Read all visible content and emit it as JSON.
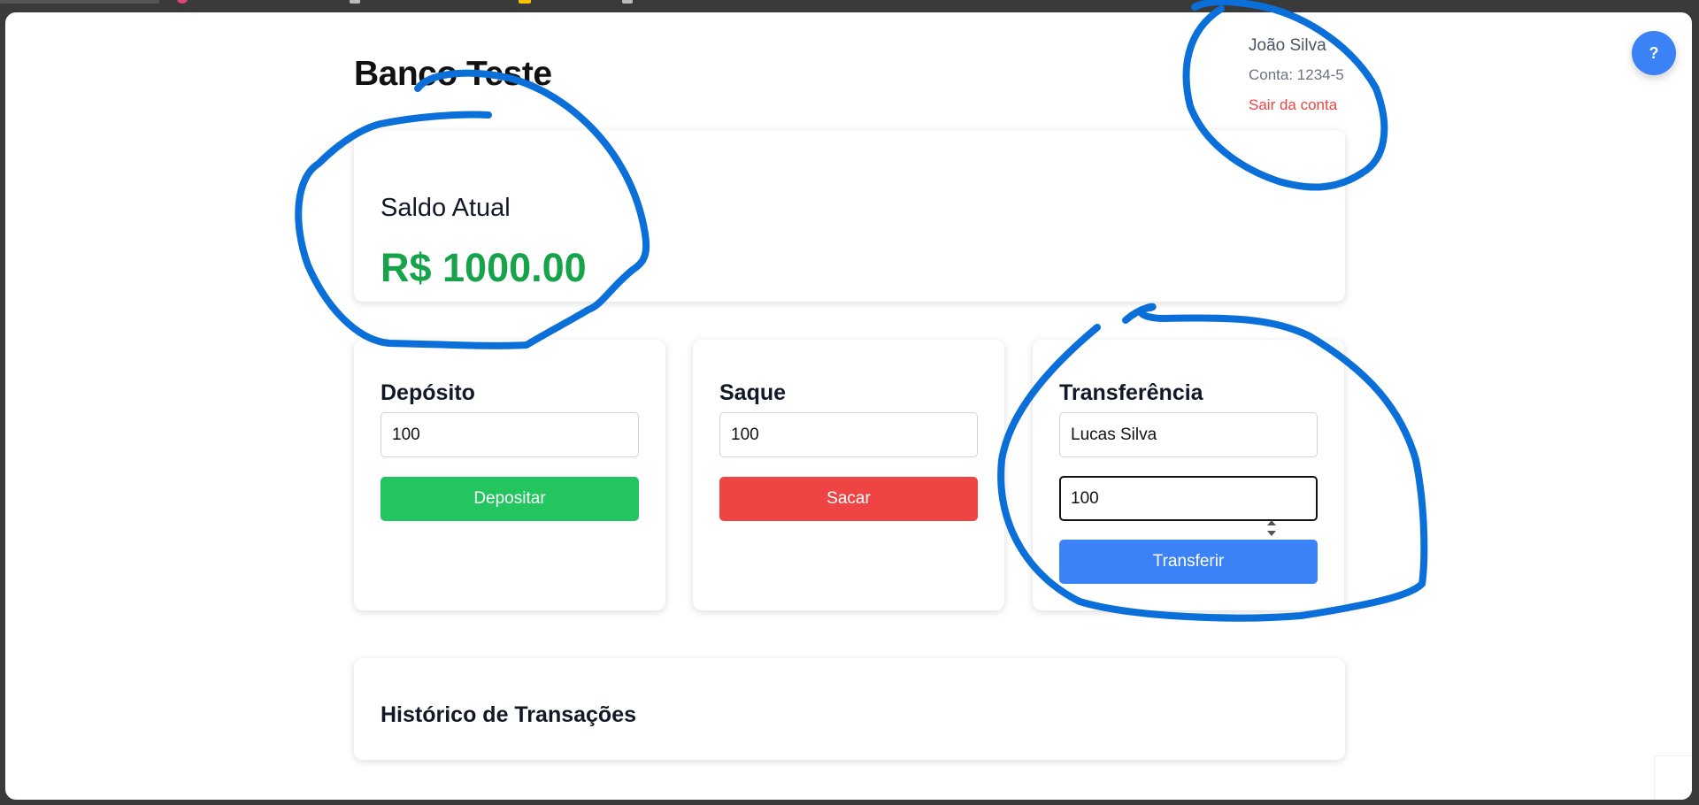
{
  "header": {
    "bank_name": "Banco Teste"
  },
  "user": {
    "name": "João Silva",
    "account": "Conta: 1234-5",
    "logout_label": "Sair da conta"
  },
  "help": {
    "label": "?"
  },
  "balance": {
    "label": "Saldo Atual",
    "value": "R$ 1000.00"
  },
  "deposit": {
    "title": "Depósito",
    "amount_value": "100",
    "button_label": "Depositar"
  },
  "withdraw": {
    "title": "Saque",
    "amount_value": "100",
    "button_label": "Sacar"
  },
  "transfer": {
    "title": "Transferência",
    "recipient_value": "Lucas Silva",
    "amount_value": "100",
    "button_label": "Transferir"
  },
  "history": {
    "title": "Histórico de Transações"
  },
  "colors": {
    "primary_blue": "#3b82f6",
    "success_green": "#22c55e",
    "balance_green": "#16a34a",
    "danger_red": "#ef4444",
    "annotation_blue": "#0a6fd8"
  }
}
